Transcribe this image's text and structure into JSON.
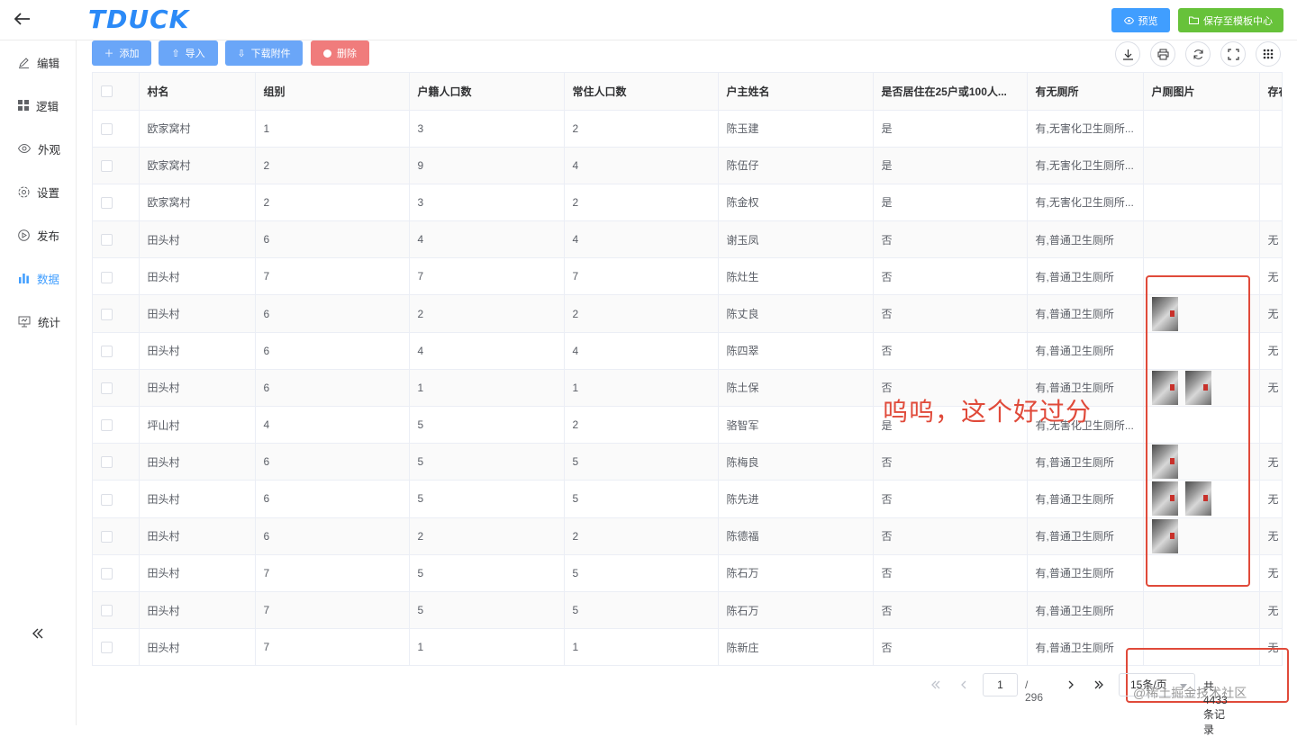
{
  "app": {
    "logo_text": "TDUCK",
    "accent": "#409eff",
    "success": "#67c23a",
    "danger": "#f56c6c"
  },
  "header": {
    "preview_label": "预览",
    "save_template_label": "保存至模板中心"
  },
  "sidebar": {
    "items": [
      {
        "label": "编辑",
        "icon": "edit-icon"
      },
      {
        "label": "逻辑",
        "icon": "grid-icon"
      },
      {
        "label": "外观",
        "icon": "eye-icon"
      },
      {
        "label": "设置",
        "icon": "gear-icon"
      },
      {
        "label": "发布",
        "icon": "play-circle-icon"
      },
      {
        "label": "数据",
        "icon": "bar-chart-icon",
        "active": true
      },
      {
        "label": "统计",
        "icon": "presentation-icon"
      }
    ]
  },
  "toolbar": {
    "add": "添加",
    "import": "导入",
    "download": "下载附件",
    "delete": "删除"
  },
  "table": {
    "columns": [
      "村名",
      "组别",
      "户籍人口数",
      "常住人口数",
      "户主姓名",
      "是否居住在25户或100人...",
      "有无厕所",
      "户厕图片",
      "存在"
    ],
    "rows": [
      {
        "cells": [
          "欧家窝村",
          "1",
          "3",
          "2",
          "陈玉建",
          "是",
          "有,无害化卫生厕所...",
          "",
          ""
        ],
        "images": 0
      },
      {
        "cells": [
          "欧家窝村",
          "2",
          "9",
          "4",
          "陈伍仔",
          "是",
          "有,无害化卫生厕所...",
          "",
          ""
        ],
        "images": 0
      },
      {
        "cells": [
          "欧家窝村",
          "2",
          "3",
          "2",
          "陈金权",
          "是",
          "有,无害化卫生厕所...",
          "",
          ""
        ],
        "images": 0
      },
      {
        "cells": [
          "田头村",
          "6",
          "4",
          "4",
          "谢玉凤",
          "否",
          "有,普通卫生厕所",
          "",
          "无"
        ],
        "images": 0
      },
      {
        "cells": [
          "田头村",
          "7",
          "7",
          "7",
          "陈灶生",
          "否",
          "有,普通卫生厕所",
          "",
          "无"
        ],
        "images": 0
      },
      {
        "cells": [
          "田头村",
          "6",
          "2",
          "2",
          "陈丈良",
          "否",
          "有,普通卫生厕所",
          "",
          "无"
        ],
        "images": 1
      },
      {
        "cells": [
          "田头村",
          "6",
          "4",
          "4",
          "陈四翠",
          "否",
          "有,普通卫生厕所",
          "",
          "无"
        ],
        "images": 0
      },
      {
        "cells": [
          "田头村",
          "6",
          "1",
          "1",
          "陈土保",
          "否",
          "有,普通卫生厕所",
          "",
          "无"
        ],
        "images": 2
      },
      {
        "cells": [
          "坪山村",
          "4",
          "5",
          "2",
          "骆智军",
          "是",
          "有,无害化卫生厕所...",
          "",
          ""
        ],
        "images": 0
      },
      {
        "cells": [
          "田头村",
          "6",
          "5",
          "5",
          "陈梅良",
          "否",
          "有,普通卫生厕所",
          "",
          "无"
        ],
        "images": 1
      },
      {
        "cells": [
          "田头村",
          "6",
          "5",
          "5",
          "陈先进",
          "否",
          "有,普通卫生厕所",
          "",
          "无"
        ],
        "images": 2
      },
      {
        "cells": [
          "田头村",
          "6",
          "2",
          "2",
          "陈德福",
          "否",
          "有,普通卫生厕所",
          "",
          "无"
        ],
        "images": 1
      },
      {
        "cells": [
          "田头村",
          "7",
          "5",
          "5",
          "陈石万",
          "否",
          "有,普通卫生厕所",
          "",
          "无"
        ],
        "images": 0
      },
      {
        "cells": [
          "田头村",
          "7",
          "5",
          "5",
          "陈石万",
          "否",
          "有,普通卫生厕所",
          "",
          "无"
        ],
        "images": 0
      },
      {
        "cells": [
          "田头村",
          "7",
          "1",
          "1",
          "陈新庄",
          "否",
          "有,普通卫生厕所",
          "",
          "无"
        ],
        "images": 0
      }
    ]
  },
  "pagination": {
    "current_page": "1",
    "total_pages": "/ 296",
    "page_size": "15条/页",
    "total_records": "共 4433 条记录"
  },
  "annotation": {
    "text": "呜呜，这个好过分",
    "color": "#e04a3a"
  },
  "watermark": "@稀土掘金技术社区"
}
